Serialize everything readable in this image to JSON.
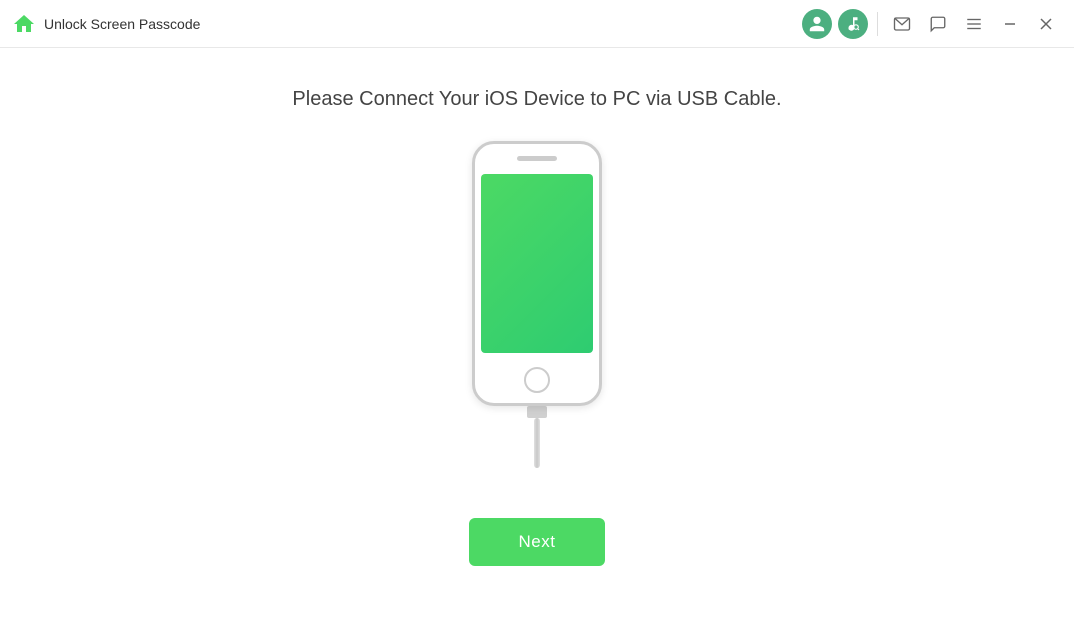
{
  "titlebar": {
    "app_title": "Unlock Screen Passcode",
    "home_icon": "home-icon",
    "account_icon": "👤",
    "music_icon": "♪",
    "mail_icon": "✉",
    "chat_icon": "💬",
    "menu_icon": "☰",
    "minimize_icon": "—",
    "close_icon": "✕"
  },
  "main": {
    "instruction": "Please Connect Your iOS Device to PC via USB Cable.",
    "next_button_label": "Next"
  }
}
